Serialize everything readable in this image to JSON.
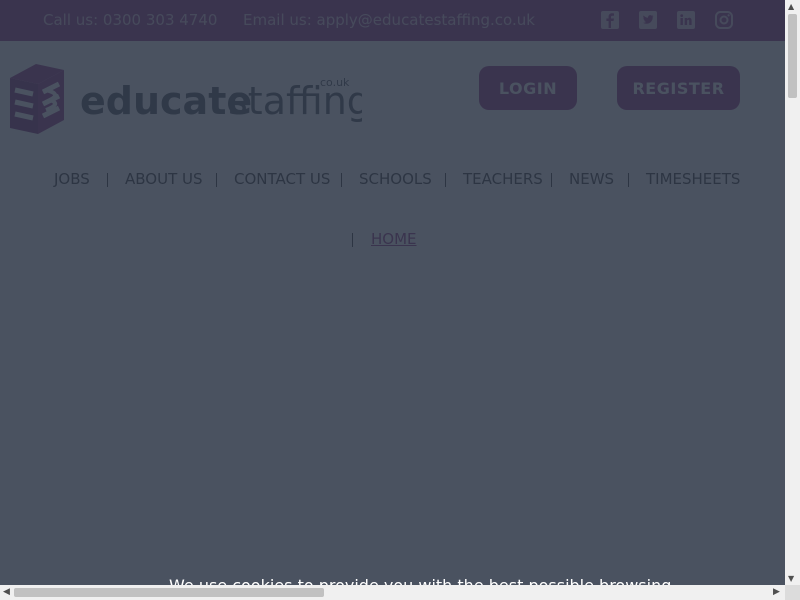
{
  "header": {
    "phone": "Call us: 0300 303 4740",
    "email": "Email us: apply@educatestaffing.co.uk",
    "social": [
      "facebook-icon",
      "twitter-icon",
      "linkedin-icon",
      "instagram-icon"
    ]
  },
  "logo": {
    "word1": "educate",
    "word2": "staffing",
    "suffix": "co.uk"
  },
  "buttons": {
    "login": "LOGIN",
    "register": "REGISTER"
  },
  "nav": {
    "items": [
      "JOBS",
      "ABOUT US",
      "CONTACT US",
      "SCHOOLS",
      "TEACHERS",
      "NEWS",
      "TIMESHEETS"
    ]
  },
  "breadcrumb": {
    "home": "HOME"
  },
  "cookie": {
    "text": "We use cookies to provide you with the best possible browsing"
  },
  "colors": {
    "brand": "#8e2c7f",
    "overlay": "#2c3646"
  }
}
